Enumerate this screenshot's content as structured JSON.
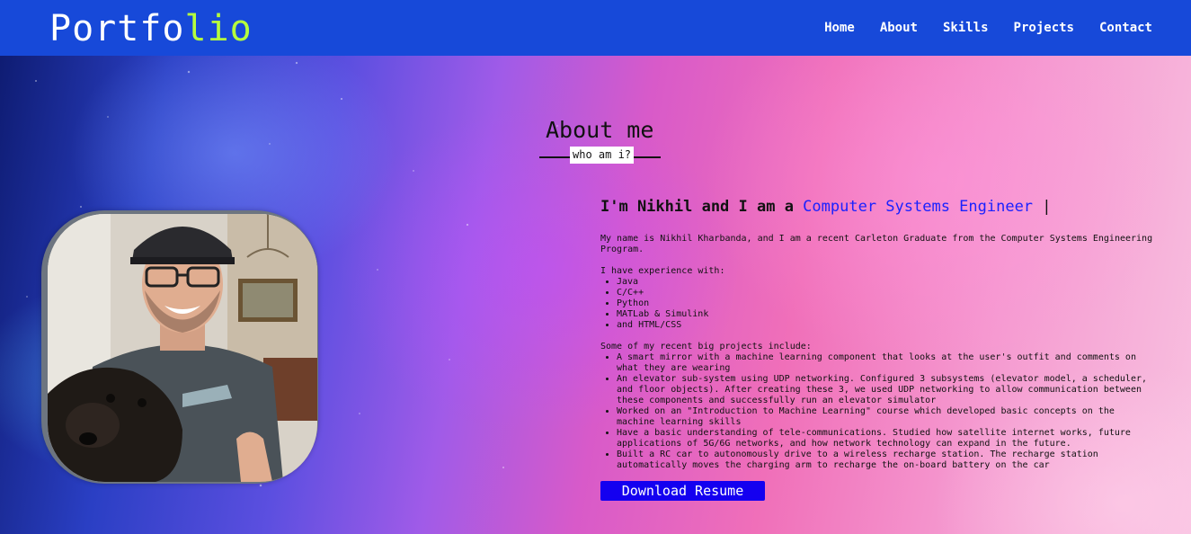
{
  "navbar": {
    "logo_main": "Portfo",
    "logo_accent": "lio",
    "links": [
      "Home",
      "About",
      "Skills",
      "Projects",
      "Contact"
    ]
  },
  "about": {
    "title": "About me",
    "subtitle": "who am i?",
    "intro_prefix": "I'm Nikhil and I am a ",
    "intro_role": "Computer Systems Engineer",
    "intro_cursor": "|",
    "summary": "My name is Nikhil Kharbanda, and I am a recent Carleton Graduate from the Computer Systems Engineering Program.",
    "experience_heading": "I have experience with:",
    "experience": [
      "Java",
      "C/C++",
      "Python",
      "MATLab & Simulink",
      "and HTML/CSS"
    ],
    "projects_heading": "Some of my recent big projects include:",
    "projects": [
      "A smart mirror with a machine learning component that looks at the user's outfit and comments on what they are wearing",
      "An elevator sub-system using UDP networking. Configured 3 subsystems (elevator model, a scheduler, and floor objects). After creating these 3, we used UDP networking to allow communication between these components and successfully run an elevator simulator",
      "Worked on an \"Introduction to Machine Learning\" course which developed basic concepts on the machine learning skills",
      "Have a basic understanding of tele-communications. Studied how satellite internet works, future applications of 5G/6G networks, and how network technology can expand in the future.",
      "Built a RC car to autonomously drive to a wireless recharge station. The recharge station automatically moves the charging arm to recharge the on-board battery on the car"
    ],
    "resume_label": "Download Resume"
  },
  "colors": {
    "navbar": "#1749d9",
    "logo_accent": "#b6ff3d",
    "role_text": "#1a22ff",
    "resume_button": "#1400f0"
  }
}
